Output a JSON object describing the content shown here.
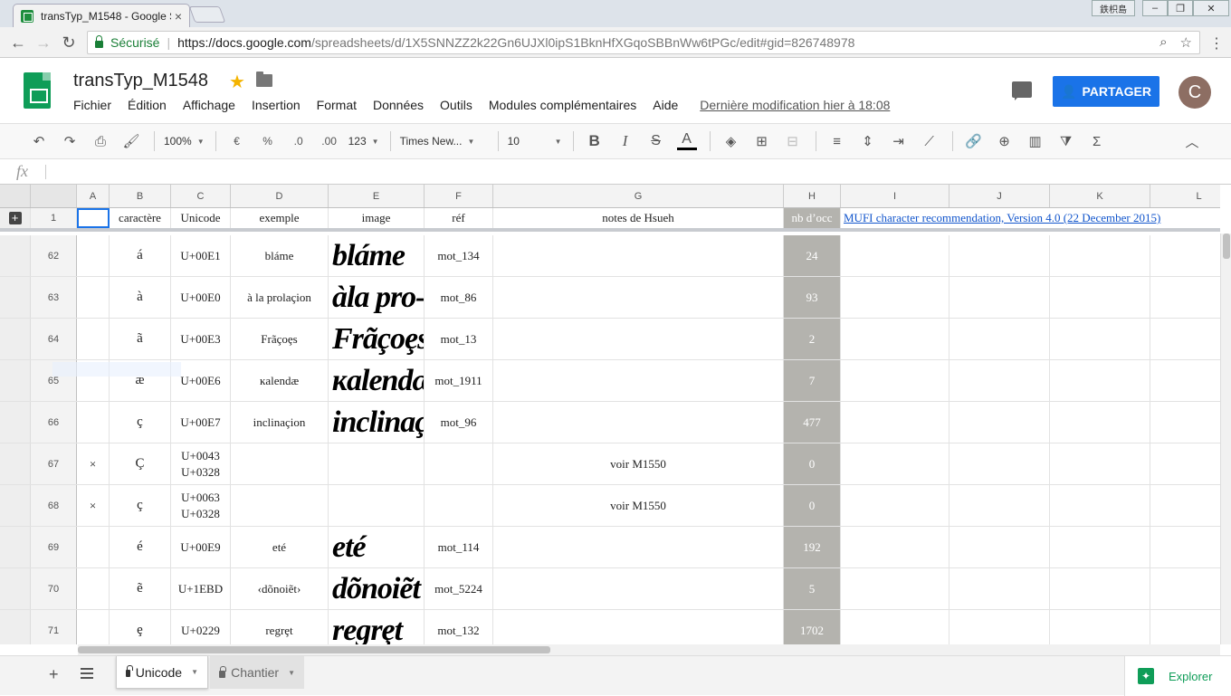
{
  "browser": {
    "tab_title": "transTyp_M1548 - Google S",
    "user_badge": "鉄枳島",
    "secure_label": "Sécurisé",
    "url_host": "https://docs.google.com",
    "url_path": "/spreadsheets/d/1X5SNNZZ2k22Gn6UJXl0ipS1BknHfXGqoSBBnWw6tPGc/edit#gid=826748978"
  },
  "app": {
    "title": "transTyp_M1548",
    "menu": [
      "Fichier",
      "Édition",
      "Affichage",
      "Insertion",
      "Format",
      "Données",
      "Outils",
      "Modules complémentaires",
      "Aide"
    ],
    "last_modified": "Dernière modification hier à 18:08",
    "share_label": "PARTAGER",
    "avatar_letter": "C",
    "brand_color": "#0f9d58",
    "share_color": "#1a73e8"
  },
  "toolbar": {
    "zoom": "100%",
    "currency": "€",
    "percent": "%",
    "dec_less": ".0",
    "dec_more": ".00",
    "more_formats": "123",
    "font": "Times New...",
    "size": "10",
    "bold": "B",
    "italic": "I",
    "strike": "S",
    "textcolor": "A",
    "sum": "Σ"
  },
  "formula_bar": {
    "fx": "fx",
    "value": ""
  },
  "grid": {
    "columns": [
      "A",
      "B",
      "C",
      "D",
      "E",
      "F",
      "G",
      "H",
      "I",
      "J",
      "K",
      "L"
    ],
    "header_row": {
      "num": "1",
      "caractere": "caractère",
      "unicode": "Unicode",
      "exemple": "exemple",
      "image": "image",
      "ref": "réf",
      "notes": "notes de Hsueh",
      "nbocc": "nb d’occ",
      "link": "MUFI character recommendation, Version 4.0 (22 December 2015)"
    },
    "rows": [
      {
        "num": "62",
        "a": "",
        "char": "á",
        "unicode": "U+00E1",
        "unicode2": "",
        "exemple": "bláme",
        "image": "bláme",
        "ref": "mot_134",
        "notes": "",
        "nbocc": "24"
      },
      {
        "num": "63",
        "a": "",
        "char": "à",
        "unicode": "U+00E0",
        "unicode2": "",
        "exemple": "à la prolaçion",
        "image": "àla pro-",
        "ref": "mot_86",
        "notes": "",
        "nbocc": "93"
      },
      {
        "num": "64",
        "a": "",
        "char": "ã",
        "unicode": "U+00E3",
        "unicode2": "",
        "exemple": "Frãçoȩs",
        "image": "Frãçoȩs",
        "ref": "mot_13",
        "notes": "",
        "nbocc": "2"
      },
      {
        "num": "65",
        "a": "",
        "char": "æ",
        "unicode": "U+00E6",
        "unicode2": "",
        "exemple": "ĸalendæ",
        "image": "ĸalendæ",
        "ref": "mot_1911",
        "notes": "",
        "nbocc": "7"
      },
      {
        "num": "66",
        "a": "",
        "char": "ç",
        "unicode": "U+00E7",
        "unicode2": "",
        "exemple": "inclinaçion",
        "image": "inclinaçion",
        "ref": "mot_96",
        "notes": "",
        "nbocc": "477"
      },
      {
        "num": "67",
        "a": "×",
        "char": "Ç",
        "unicode": "U+0043",
        "unicode2": "U+0328",
        "exemple": "",
        "image": "",
        "ref": "",
        "notes": "voir M1550",
        "nbocc": "0"
      },
      {
        "num": "68",
        "a": "×",
        "char": "ç",
        "unicode": "U+0063",
        "unicode2": "U+0328",
        "exemple": "",
        "image": "",
        "ref": "",
        "notes": "voir M1550",
        "nbocc": "0"
      },
      {
        "num": "69",
        "a": "",
        "char": "é",
        "unicode": "U+00E9",
        "unicode2": "",
        "exemple": "eté",
        "image": "eté",
        "ref": "mot_114",
        "notes": "",
        "nbocc": "192"
      },
      {
        "num": "70",
        "a": "",
        "char": "ẽ",
        "unicode": "U+1EBD",
        "unicode2": "",
        "exemple": "‹dõnoiẽt›",
        "image": "dõnoiẽt",
        "ref": "mot_5224",
        "notes": "",
        "nbocc": "5"
      },
      {
        "num": "71",
        "a": "",
        "char": "ȩ",
        "unicode": "U+0229",
        "unicode2": "",
        "exemple": "regrȩt",
        "image": "regrȩt",
        "ref": "mot_132",
        "notes": "",
        "nbocc": "1702"
      }
    ]
  },
  "sheets": {
    "tabs": [
      "Unicode",
      "Chantier"
    ],
    "explore_label": "Explorer"
  }
}
